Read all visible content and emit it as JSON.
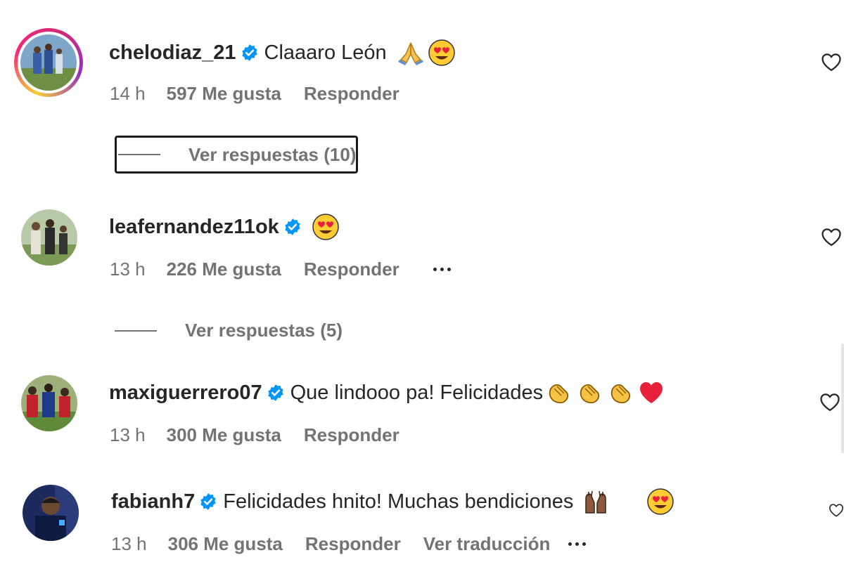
{
  "comments": [
    {
      "username": "chelodiaz_21",
      "text": "Claaaro León",
      "emojis": [
        "folded-hands-emoji",
        "heart-eyes-emoji"
      ],
      "time": "14 h",
      "likes": "597 Me gusta",
      "reply": "Responder",
      "replies": "Ver respuestas (10)"
    },
    {
      "username": "leafernandez11ok",
      "text": "",
      "emojis": [
        "heart-eyes-emoji"
      ],
      "time": "13 h",
      "likes": "226 Me gusta",
      "reply": "Responder",
      "replies": "Ver respuestas (5)"
    },
    {
      "username": "maxiguerrero07",
      "text": "Que lindooo pa! Felicidades",
      "emojis": [
        "clapping-hands-emoji",
        "clapping-hands-emoji",
        "clapping-hands-emoji",
        "red-heart-emoji"
      ],
      "time": "13 h",
      "likes": "300 Me gusta",
      "reply": "Responder"
    },
    {
      "username": "fabianh7",
      "text": "Felicidades hnito! Muchas bendiciones",
      "emojis": [
        "raising-hands-emoji",
        "heart-eyes-emoji"
      ],
      "time": "13 h",
      "likes": "306 Me gusta",
      "reply": "Responder",
      "translate": "Ver traducción"
    }
  ],
  "colors": {
    "verified": "#0095f6",
    "secondary_text": "#737373",
    "primary_text": "#262626"
  }
}
